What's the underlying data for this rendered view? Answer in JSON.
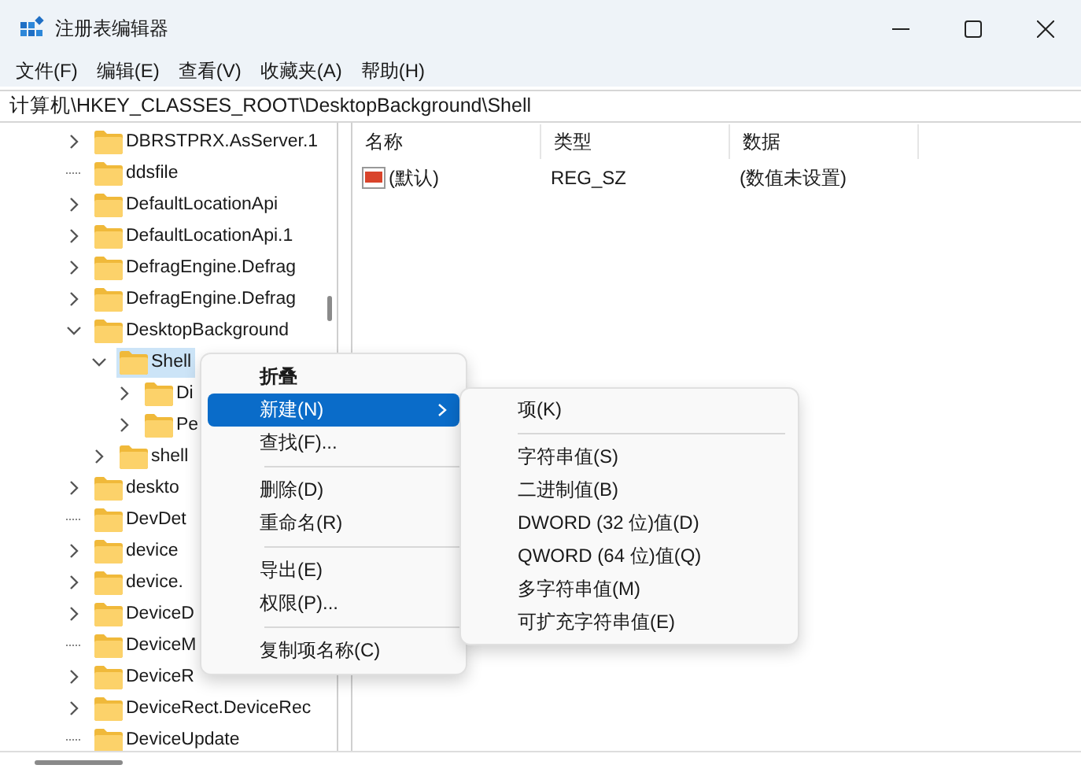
{
  "window": {
    "title": "注册表编辑器"
  },
  "menu_bar": [
    "文件(F)",
    "编辑(E)",
    "查看(V)",
    "收藏夹(A)",
    "帮助(H)"
  ],
  "address": "计算机\\HKEY_CLASSES_ROOT\\DesktopBackground\\Shell",
  "tree": [
    {
      "label": "DBRSTPRX.AsServer.1",
      "expandable": true,
      "expanded": false,
      "selected": false
    },
    {
      "label": "ddsfile",
      "expandable": false,
      "selected": false
    },
    {
      "label": "DefaultLocationApi",
      "expandable": true,
      "expanded": false,
      "selected": false
    },
    {
      "label": "DefaultLocationApi.1",
      "expandable": true,
      "expanded": false,
      "selected": false
    },
    {
      "label": "DefragEngine.Defrag",
      "expandable": true,
      "expanded": false,
      "selected": false
    },
    {
      "label": "DefragEngine.Defrag",
      "expandable": true,
      "expanded": false,
      "selected": false
    },
    {
      "label": "DesktopBackground",
      "expandable": true,
      "expanded": true,
      "selected": false,
      "children": [
        {
          "label": "Shell",
          "expandable": true,
          "expanded": true,
          "selected": true,
          "children": [
            {
              "label": "Di",
              "expandable": true,
              "expanded": false,
              "selected": false
            },
            {
              "label": "Pe",
              "expandable": true,
              "expanded": false,
              "selected": false
            }
          ]
        },
        {
          "label": "shell",
          "expandable": true,
          "expanded": false,
          "selected": false
        }
      ]
    },
    {
      "label": "deskto",
      "expandable": true,
      "expanded": false,
      "selected": false
    },
    {
      "label": "DevDet",
      "expandable": false,
      "selected": false
    },
    {
      "label": "device",
      "expandable": true,
      "expanded": false,
      "selected": false
    },
    {
      "label": "device.",
      "expandable": true,
      "expanded": false,
      "selected": false
    },
    {
      "label": "DeviceD",
      "expandable": true,
      "expanded": false,
      "selected": false
    },
    {
      "label": "DeviceM",
      "expandable": false,
      "selected": false
    },
    {
      "label": "DeviceR",
      "expandable": true,
      "expanded": false,
      "selected": false
    },
    {
      "label": "DeviceRect.DeviceRec",
      "expandable": true,
      "expanded": false,
      "selected": false
    },
    {
      "label": "DeviceUpdate",
      "expandable": false,
      "selected": false
    }
  ],
  "values": {
    "columns": [
      "名称",
      "类型",
      "数据"
    ],
    "rows": [
      {
        "name": "(默认)",
        "type": "REG_SZ",
        "data": "(数值未设置)"
      }
    ]
  },
  "context_menu": [
    {
      "kind": "item",
      "label": "折叠",
      "default": true,
      "selected": false,
      "submenu": false
    },
    {
      "kind": "item",
      "label": "新建(N)",
      "default": false,
      "selected": true,
      "submenu": true
    },
    {
      "kind": "item",
      "label": "查找(F)...",
      "default": false,
      "selected": false,
      "submenu": false
    },
    {
      "kind": "separator"
    },
    {
      "kind": "item",
      "label": "删除(D)",
      "default": false,
      "selected": false,
      "submenu": false
    },
    {
      "kind": "item",
      "label": "重命名(R)",
      "default": false,
      "selected": false,
      "submenu": false
    },
    {
      "kind": "separator"
    },
    {
      "kind": "item",
      "label": "导出(E)",
      "default": false,
      "selected": false,
      "submenu": false
    },
    {
      "kind": "item",
      "label": "权限(P)...",
      "default": false,
      "selected": false,
      "submenu": false
    },
    {
      "kind": "separator"
    },
    {
      "kind": "item",
      "label": "复制项名称(C)",
      "default": false,
      "selected": false,
      "submenu": false
    }
  ],
  "submenu": [
    {
      "kind": "item",
      "label": "项(K)"
    },
    {
      "kind": "separator"
    },
    {
      "kind": "item",
      "label": "字符串值(S)"
    },
    {
      "kind": "item",
      "label": "二进制值(B)"
    },
    {
      "kind": "item",
      "label": "DWORD (32 位)值(D)"
    },
    {
      "kind": "item",
      "label": "QWORD (64 位)值(Q)"
    },
    {
      "kind": "item",
      "label": "多字符串值(M)"
    },
    {
      "kind": "item",
      "label": "可扩充字符串值(E)"
    }
  ]
}
